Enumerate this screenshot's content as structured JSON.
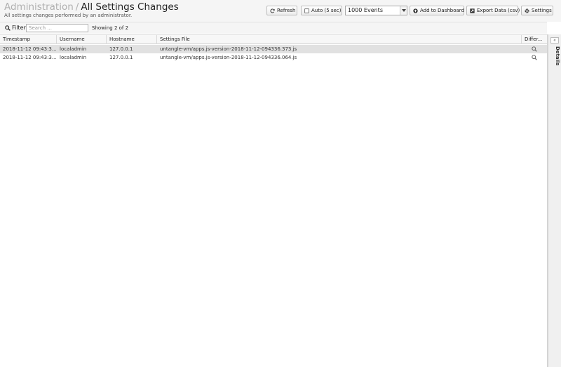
{
  "breadcrumb": {
    "parent": "Administration",
    "separator": "/",
    "current": "All Settings Changes"
  },
  "subtitle": "All settings changes performed by an administrator.",
  "toolbar": {
    "refresh": "Refresh",
    "auto": "Auto (5 sec)",
    "events_selected": "1000 Events",
    "add_dashboard": "Add to Dashboard",
    "export": "Export Data (csv)",
    "settings": "Settings"
  },
  "filter": {
    "label": "Filter",
    "placeholder": "Search ...",
    "showing": "Showing 2 of 2"
  },
  "grid": {
    "columns": [
      "Timestamp",
      "Username",
      "Hostname",
      "Settings File",
      "Differ..."
    ],
    "rows": [
      {
        "timestamp": "2018-11-12 09:43:3...",
        "username": "localadmin",
        "hostname": "127.0.0.1",
        "file": "untangle-vm/apps.js-version-2018-11-12-094336.373.js"
      },
      {
        "timestamp": "2018-11-12 09:43:3...",
        "username": "localadmin",
        "hostname": "127.0.0.1",
        "file": "untangle-vm/apps.js-version-2018-11-12-094336.064.js"
      }
    ]
  },
  "details": {
    "label": "Details"
  }
}
